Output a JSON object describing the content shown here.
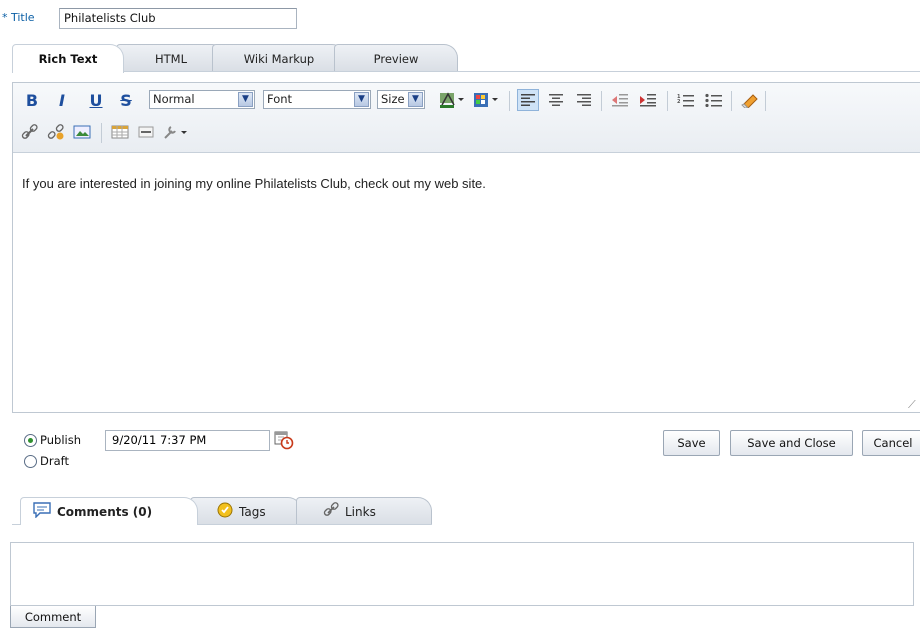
{
  "title_field": {
    "label": "Title",
    "required_mark": "*",
    "value": "Philatelists Club"
  },
  "editor_tabs": [
    {
      "label": "Rich Text",
      "active": true
    },
    {
      "label": "HTML",
      "active": false
    },
    {
      "label": "Wiki Markup",
      "active": false
    },
    {
      "label": "Preview",
      "active": false
    }
  ],
  "toolbar": {
    "bold": "B",
    "italic": "I",
    "underline": "U",
    "strike": "S",
    "format_select": "Normal",
    "font_select": "Font",
    "size_select": "Size"
  },
  "content_text": "If you are interested in joining my online Philatelists Club, check out my web site.",
  "publish": {
    "publish_label": "Publish",
    "draft_label": "Draft",
    "selected": "Publish",
    "date_value": "9/20/11 7:37 PM"
  },
  "buttons": {
    "save": "Save",
    "save_close": "Save and Close",
    "cancel": "Cancel"
  },
  "lower_tabs": [
    {
      "label": "Comments (0)",
      "icon": "comment-icon",
      "active": true
    },
    {
      "label": "Tags",
      "icon": "tag-icon",
      "active": false
    },
    {
      "label": "Links",
      "icon": "link-icon",
      "active": false
    }
  ],
  "comment_button": "Comment",
  "colors": {
    "accent_blue": "#1e4f9e",
    "border": "#bfc8d2",
    "active_align": "#cfe3f7"
  }
}
